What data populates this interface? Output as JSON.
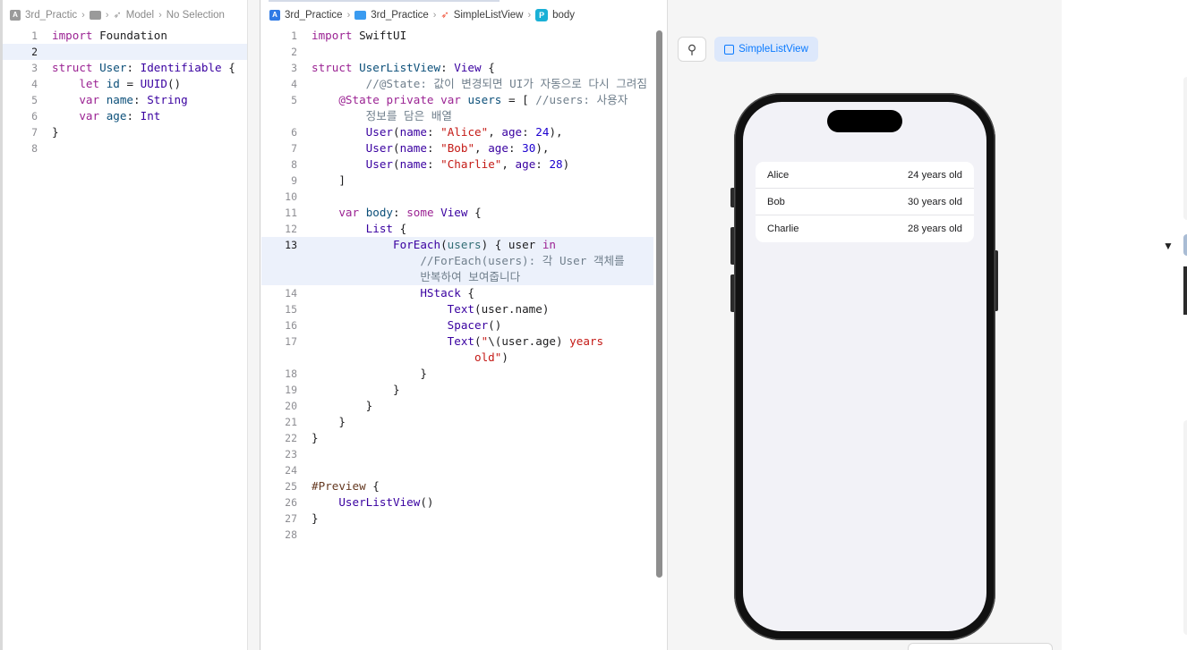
{
  "left_editor": {
    "breadcrumbs": [
      "3rd_Practic",
      "Model",
      "No Selection"
    ],
    "lines": [
      {
        "n": "1",
        "html": "<span class='kw'>import</span> Foundation"
      },
      {
        "n": "2",
        "html": ""
      },
      {
        "n": "3",
        "html": "<span class='kw'>struct</span> <span class='ty'>User</span>: <span class='tn'>Identifiable</span> {"
      },
      {
        "n": "4",
        "html": "    <span class='kw'>let</span> <span class='ty'>id</span> = <span class='tn'>UUID</span>()"
      },
      {
        "n": "5",
        "html": "    <span class='kw'>var</span> <span class='ty'>name</span>: <span class='tn'>String</span>"
      },
      {
        "n": "6",
        "html": "    <span class='kw'>var</span> <span class='ty'>age</span>: <span class='tn'>Int</span>"
      },
      {
        "n": "7",
        "html": "}"
      },
      {
        "n": "8",
        "html": ""
      }
    ],
    "current_line": "2"
  },
  "main_editor": {
    "breadcrumbs": [
      "3rd_Practice",
      "3rd_Practice",
      "SimpleListView",
      "body"
    ],
    "lines": [
      {
        "n": "1",
        "html": "<span class='kw'>import</span> SwiftUI"
      },
      {
        "n": "2",
        "html": ""
      },
      {
        "n": "3",
        "html": "<span class='kw'>struct</span> <span class='ty'>UserListView</span>: <span class='tn'>View</span> {"
      },
      {
        "n": "4",
        "html": "        <span class='cm'>//@State: 값이 변경되면 UI가 자동으로 다시 그려짐</span>"
      },
      {
        "n": "5",
        "html": "    <span class='kw'>@State</span> <span class='kw'>private</span> <span class='kw'>var</span> <span class='ty'>users</span> = [ <span class='cm'>//users: 사용자</span>"
      },
      {
        "n": "",
        "html": "        <span class='cm'>정보를 담은 배열</span>"
      },
      {
        "n": "6",
        "html": "        <span class='tn'>User</span>(<span class='tn'>name</span>: <span class='str'>\"Alice\"</span>, <span class='tn'>age</span>: <span class='num'>24</span>),"
      },
      {
        "n": "7",
        "html": "        <span class='tn'>User</span>(<span class='tn'>name</span>: <span class='str'>\"Bob\"</span>, <span class='tn'>age</span>: <span class='num'>30</span>),"
      },
      {
        "n": "8",
        "html": "        <span class='tn'>User</span>(<span class='tn'>name</span>: <span class='str'>\"Charlie\"</span>, <span class='tn'>age</span>: <span class='num'>28</span>)"
      },
      {
        "n": "9",
        "html": "    ]"
      },
      {
        "n": "10",
        "html": ""
      },
      {
        "n": "11",
        "html": "    <span class='kw'>var</span> <span class='ty'>body</span>: <span class='kw'>some</span> <span class='tn'>View</span> {"
      },
      {
        "n": "12",
        "html": "        <span class='tn'>List</span> {"
      },
      {
        "n": "13",
        "html": "            <span class='tn'>ForEach</span>(<span class='prop'>users</span>) { user <span class='kw'>in</span>"
      },
      {
        "n": "",
        "html": "                <span class='cm'>//ForEach(users): 각 User 객체를</span>"
      },
      {
        "n": "",
        "html": "                <span class='cm'>반복하여 보여줍니다</span>"
      },
      {
        "n": "14",
        "html": "                <span class='tn'>HStack</span> {"
      },
      {
        "n": "15",
        "html": "                    <span class='tn'>Text</span>(user.name)"
      },
      {
        "n": "16",
        "html": "                    <span class='tn'>Spacer</span>()"
      },
      {
        "n": "17",
        "html": "                    <span class='tn'>Text</span>(<span class='str'>\"</span>\\(user.age)<span class='str'> years</span>"
      },
      {
        "n": "",
        "html": "                        <span class='str'>old\"</span>)"
      },
      {
        "n": "18",
        "html": "                }"
      },
      {
        "n": "19",
        "html": "            }"
      },
      {
        "n": "20",
        "html": "        }"
      },
      {
        "n": "21",
        "html": "    }"
      },
      {
        "n": "22",
        "html": "}"
      },
      {
        "n": "23",
        "html": ""
      },
      {
        "n": "24",
        "html": ""
      },
      {
        "n": "25",
        "html": "<span class='pre'>#Preview</span> {"
      },
      {
        "n": "26",
        "html": "    <span class='tn'>UserListView</span>()"
      },
      {
        "n": "27",
        "html": "}"
      },
      {
        "n": "28",
        "html": ""
      }
    ],
    "current_line": "13"
  },
  "canvas": {
    "pin_icon": "pin-icon",
    "preview_tab_label": "SimpleListView",
    "list_rows": [
      {
        "name": "Alice",
        "age": "24 years old"
      },
      {
        "name": "Bob",
        "age": "30 years old"
      },
      {
        "name": "Charlie",
        "age": "28 years old"
      }
    ]
  },
  "colors": {
    "accent": "#0a7aff",
    "highlight_line": "#ecf1fb",
    "preview_bg": "#f2f2f7"
  }
}
